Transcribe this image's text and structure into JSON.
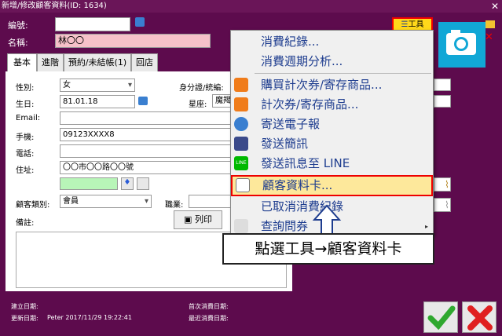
{
  "window": {
    "title": "新增/修改顧客資料(ID: 1634)",
    "close_icon": "close-icon"
  },
  "header": {
    "number_label": "編號:",
    "number_value": "",
    "name_label": "名稱:",
    "name_value": "林〇〇"
  },
  "tabs": [
    "基本",
    "進階",
    "預約/未結帳(1)",
    "回店"
  ],
  "form": {
    "gender_label": "性別:",
    "gender_value": "女",
    "birthday_label": "生日:",
    "birthday_value": "81.01.18",
    "email_label": "Email:",
    "email_value": "",
    "mobile_label": "手機:",
    "mobile_value": "09123XXXX8",
    "phone_label": "電話:",
    "phone_value": "",
    "address_label": "住址:",
    "address_value": "〇〇市〇〇路〇〇號",
    "id_label": "身分證/統編:",
    "zodiac_label": "星座:",
    "zodiac_value": "魔羯",
    "category_label": "顧客類別:",
    "category_value": "會員",
    "job_label": "職業:",
    "print_button": "列印",
    "note_label": "備註:"
  },
  "tools_button": "工具",
  "menu": {
    "items": [
      "消費紀錄...",
      "消費週期分析...",
      "購買計次券/寄存商品...",
      "計次券/寄存商品...",
      "寄送電子報",
      "發送簡訊",
      "發送訊息至 LINE",
      "顧客資料卡...",
      "已取消消費紀錄",
      "查詢問券"
    ],
    "highlighted_index": 7
  },
  "callout": "點選工具→顧客資料卡",
  "footer": {
    "created_label": "建立日期:",
    "created_value": "",
    "updated_label": "更新日期:",
    "updated_value": "Peter 2017/11/29 19:22:41",
    "first_visit_label": "首次消費日期:",
    "last_visit_label": "最近消費日期:"
  },
  "colors": {
    "bg": "#5d0b4d",
    "highlight": "#fde89b",
    "accent_red": "#e00000",
    "link_blue": "#1e3d8f"
  }
}
